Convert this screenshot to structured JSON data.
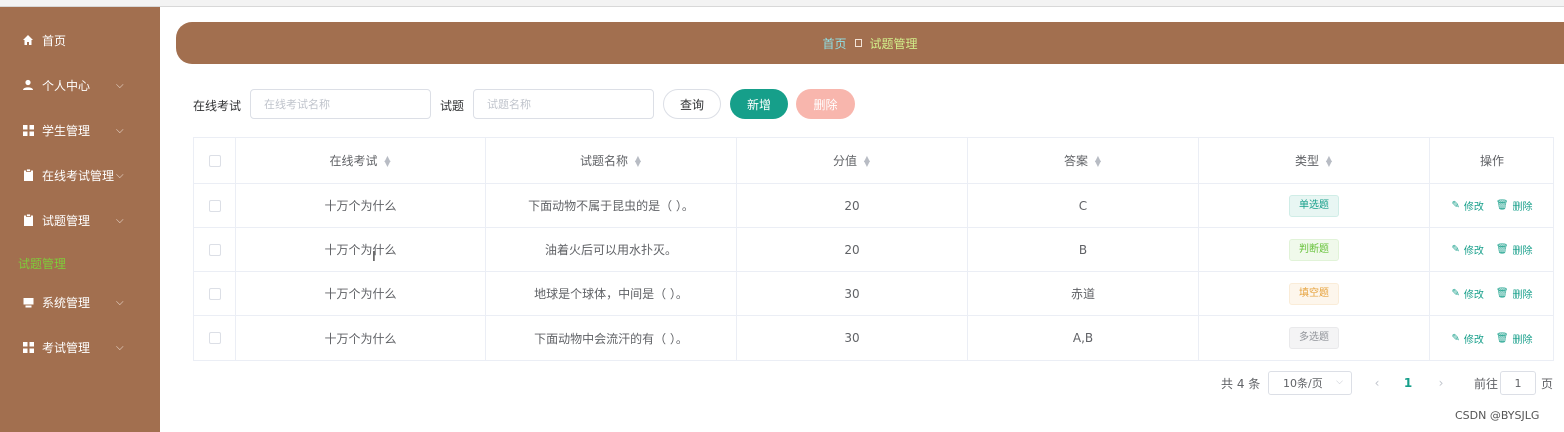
{
  "sidebar": {
    "items": [
      {
        "label": "首页",
        "icon": "home-icon",
        "chevron": false
      },
      {
        "label": "个人中心",
        "icon": "user-icon",
        "chevron": true
      },
      {
        "label": "学生管理",
        "icon": "grid-icon",
        "chevron": true
      },
      {
        "label": "在线考试管理",
        "icon": "clipboard-icon",
        "chevron": true
      },
      {
        "label": "试题管理",
        "icon": "clipboard-icon",
        "chevron": true
      },
      {
        "label": "系统管理",
        "icon": "desktop-icon",
        "chevron": true
      },
      {
        "label": "考试管理",
        "icon": "grid-icon",
        "chevron": true
      }
    ],
    "active_sub": "试题管理",
    "colors": {
      "bg": "#a26f4f",
      "active_sub": "#7fcc3a"
    }
  },
  "breadcrumb": {
    "home": "首页",
    "current": "试题管理"
  },
  "search": {
    "exam_label": "在线考试",
    "exam_placeholder": "在线考试名称",
    "question_label": "试题",
    "question_placeholder": "试题名称",
    "query_button": "查询",
    "add_button": "新增",
    "delete_button": "删除"
  },
  "table": {
    "headers": [
      "在线考试",
      "试题名称",
      "分值",
      "答案",
      "类型",
      "操作"
    ],
    "rows": [
      {
        "exam": "十万个为什么",
        "question": "下面动物不属于昆虫的是（ ）。",
        "score": "20",
        "answer": "C",
        "type": "单选题"
      },
      {
        "exam": "十万个为什么",
        "question": "油着火后可以用水扑灭。",
        "score": "20",
        "answer": "B",
        "type": "判断题"
      },
      {
        "exam": "十万个为什么",
        "question": "地球是个球体，中间是（ ）。",
        "score": "30",
        "answer": "赤道",
        "type": "填空题"
      },
      {
        "exam": "十万个为什么",
        "question": "下面动物中会流汗的有（ ）。",
        "score": "30",
        "answer": "A,B",
        "type": "多选题"
      }
    ],
    "edit_label": "修改",
    "delete_label": "删除"
  },
  "pagination": {
    "total": "共 4 条",
    "page_size": "10条/页",
    "current_page": "1",
    "goto_label": "前往",
    "goto_value": "1",
    "page_suffix": "页"
  },
  "watermark": "CSDN @BYSJLG",
  "accent": "#169f8a"
}
